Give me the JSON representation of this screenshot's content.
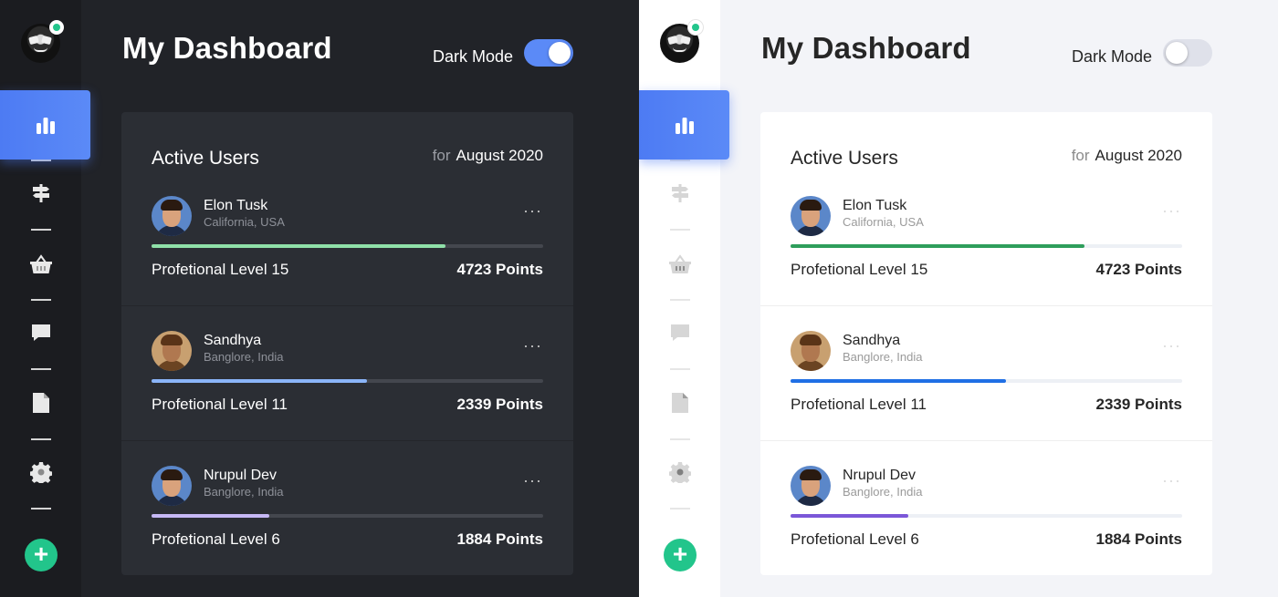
{
  "panels": [
    {
      "theme": "dark",
      "title": "My Dashboard",
      "mode_label": "Dark Mode",
      "dark_mode_on": true,
      "card": {
        "title": "Active Users",
        "period_prefix": "for",
        "period": "August 2020"
      },
      "users": [
        {
          "name": "Elon Tusk",
          "location": "California, USA",
          "level": "Profetional Level 15",
          "points": "4723 Points",
          "progress": 0.75,
          "bar_color": "#8fe0a8",
          "more": "···"
        },
        {
          "name": "Sandhya",
          "location": "Banglore, India",
          "level": "Profetional Level 11",
          "points": "2339 Points",
          "progress": 0.55,
          "bar_color": "#8ab4f8",
          "more": "···"
        },
        {
          "name": "Nrupul Dev",
          "location": "Banglore, India",
          "level": "Profetional Level 6",
          "points": "1884 Points",
          "progress": 0.3,
          "bar_color": "#c6b8f5",
          "more": "···"
        }
      ]
    },
    {
      "theme": "light",
      "title": "My Dashboard",
      "mode_label": "Dark Mode",
      "dark_mode_on": false,
      "card": {
        "title": "Active Users",
        "period_prefix": "for",
        "period": "August 2020"
      },
      "users": [
        {
          "name": "Elon Tusk",
          "location": "California, USA",
          "level": "Profetional Level 15",
          "points": "4723 Points",
          "progress": 0.75,
          "bar_color": "#2e9e5b",
          "more": "···"
        },
        {
          "name": "Sandhya",
          "location": "Banglore, India",
          "level": "Profetional Level 11",
          "points": "2339 Points",
          "progress": 0.55,
          "bar_color": "#1f6fe5",
          "more": "···"
        },
        {
          "name": "Nrupul Dev",
          "location": "Banglore, India",
          "level": "Profetional Level 6",
          "points": "1884 Points",
          "progress": 0.3,
          "bar_color": "#7b57d8",
          "more": "···"
        }
      ]
    }
  ],
  "sidebar": {
    "items": [
      {
        "icon": "bar-chart-icon",
        "active": true
      },
      {
        "icon": "signpost-icon",
        "active": false
      },
      {
        "icon": "basket-icon",
        "active": false
      },
      {
        "icon": "chat-icon",
        "active": false
      },
      {
        "icon": "document-icon",
        "active": false
      },
      {
        "icon": "gear-icon",
        "active": false
      }
    ],
    "add_label": "+"
  }
}
